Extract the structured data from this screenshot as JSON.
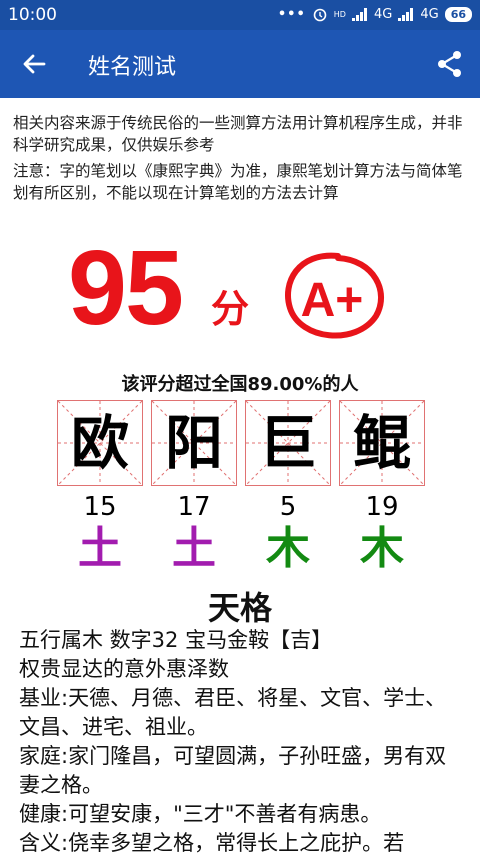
{
  "status": {
    "time": "10:00",
    "signal1": "4G",
    "signal2": "4G",
    "battery": "66",
    "hd": "HD"
  },
  "appbar": {
    "title": "姓名测试"
  },
  "notice": {
    "line1": "相关内容来源于传统民俗的一些测算方法用计算机程序生成，并非科学研究成果，仅供娱乐参考",
    "line2": "注意：字的笔划以《康熙字典》为准，康熙笔划计算方法与简体笔划有所区别，不能以现在计算笔划的方法去计算"
  },
  "score": {
    "value": "95",
    "unit": "分",
    "grade": "A+",
    "percent_text": "该评分超过全国89.00%的人"
  },
  "name_chars": [
    {
      "char": "欧",
      "strokes": "15",
      "element": "土",
      "color": "#a21caf"
    },
    {
      "char": "阳",
      "strokes": "17",
      "element": "土",
      "color": "#a21caf"
    },
    {
      "char": "巨",
      "strokes": "5",
      "element": "木",
      "color": "#138a12"
    },
    {
      "char": "鲲",
      "strokes": "19",
      "element": "木",
      "color": "#138a12"
    }
  ],
  "section": {
    "title": "天格"
  },
  "details": [
    "五行属木 数字32 宝马金鞍【吉】",
    "权贵显达的意外惠泽数",
    "基业:天德、月德、君臣、将星、文官、学士、文昌、进宅、祖业。",
    "家庭:家门隆昌，可望圆满，子孙旺盛，男有双妻之格。",
    "健康:可望安康，\"三才\"不善者有病患。",
    "含义:侥幸多望之格，常得长上之庇护。若"
  ],
  "colors": {
    "statusbar": "#1a4fa3",
    "appbar": "#1e56b4",
    "score": "#e8141a"
  }
}
